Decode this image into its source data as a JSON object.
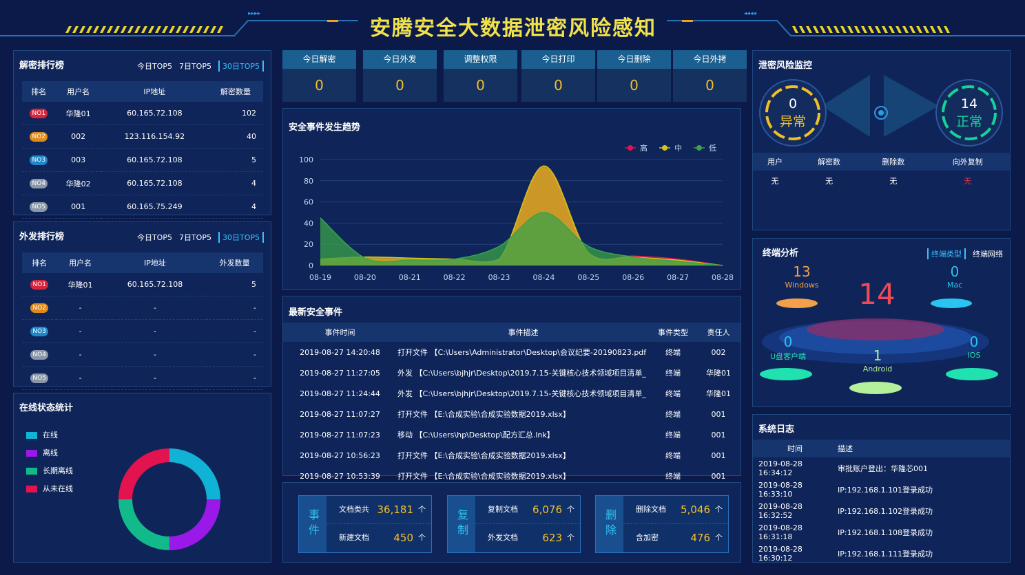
{
  "header": {
    "title": "安腾安全大数据泄密风险感知"
  },
  "decrypt_rank": {
    "title": "解密排行榜",
    "tabs": [
      "今日TOP5",
      "7日TOP5",
      "30日TOP5"
    ],
    "headers": [
      "排名",
      "用户名",
      "IP地址",
      "解密数量"
    ],
    "rows": [
      {
        "rank": "NO1",
        "user": "华隆01",
        "ip": "60.165.72.108",
        "count": "102"
      },
      {
        "rank": "NO2",
        "user": "002",
        "ip": "123.116.154.92",
        "count": "40"
      },
      {
        "rank": "NO3",
        "user": "003",
        "ip": "60.165.72.108",
        "count": "5"
      },
      {
        "rank": "NO4",
        "user": "华隆02",
        "ip": "60.165.72.108",
        "count": "4"
      },
      {
        "rank": "NO5",
        "user": "001",
        "ip": "60.165.75.249",
        "count": "4"
      }
    ]
  },
  "send_rank": {
    "title": "外发排行榜",
    "tabs": [
      "今日TOP5",
      "7日TOP5",
      "30日TOP5"
    ],
    "headers": [
      "排名",
      "用户名",
      "IP地址",
      "外发数量"
    ],
    "rows": [
      {
        "rank": "NO1",
        "user": "华隆01",
        "ip": "60.165.72.108",
        "count": "5"
      },
      {
        "rank": "NO2",
        "user": "-",
        "ip": "-",
        "count": "-"
      },
      {
        "rank": "NO3",
        "user": "-",
        "ip": "-",
        "count": "-"
      },
      {
        "rank": "NO4",
        "user": "-",
        "ip": "-",
        "count": "-"
      },
      {
        "rank": "NO5",
        "user": "-",
        "ip": "-",
        "count": "-"
      }
    ]
  },
  "badge_colors": [
    "#d9243b",
    "#e08a1c",
    "#1f86c8",
    "#8a97a8",
    "#8a97a8"
  ],
  "online": {
    "title": "在线状态统计",
    "legend": [
      {
        "label": "在线",
        "color": "#10b2d6",
        "value": 25
      },
      {
        "label": "离线",
        "color": "#9a18e8",
        "value": 25
      },
      {
        "label": "长期离线",
        "color": "#12b98a",
        "value": 25
      },
      {
        "label": "从未在线",
        "color": "#e2134f",
        "value": 25
      }
    ]
  },
  "kpis": [
    {
      "label": "今日解密",
      "value": "0"
    },
    {
      "label": "今日外发",
      "value": "0"
    },
    {
      "label": "调整权限",
      "value": "0"
    },
    {
      "label": "今日打印",
      "value": "0"
    },
    {
      "label": "今日删除",
      "value": "0"
    },
    {
      "label": "今日外拷",
      "value": "0"
    }
  ],
  "chart_data": {
    "type": "area",
    "title": "安全事件发生趋势",
    "categories": [
      "08-19",
      "08-20",
      "08-21",
      "08-22",
      "08-23",
      "08-24",
      "08-25",
      "08-26",
      "08-27",
      "08-28"
    ],
    "ylim": [
      0,
      100
    ],
    "yticks": [
      0,
      20,
      40,
      60,
      80,
      100
    ],
    "series": [
      {
        "name": "高",
        "color": "#e2134f",
        "values": [
          5,
          6,
          5,
          4,
          5,
          92,
          10,
          9,
          6,
          0
        ]
      },
      {
        "name": "中",
        "color": "#d6c41a",
        "values": [
          6,
          8,
          7,
          6,
          6,
          94,
          12,
          8,
          5,
          0
        ]
      },
      {
        "name": "低",
        "color": "#3aa34a",
        "values": [
          45,
          7,
          5,
          6,
          18,
          50,
          18,
          8,
          4,
          0
        ]
      }
    ]
  },
  "events": {
    "title": "最新安全事件",
    "headers": [
      "事件时间",
      "事件描述",
      "事件类型",
      "责任人"
    ],
    "rows": [
      {
        "time": "2019-08-27 14:20:48",
        "desc": "打开文件 【C:\\Users\\Administrator\\Desktop\\会议纪要-20190823.pdf",
        "type": "终端",
        "owner": "002"
      },
      {
        "time": "2019-08-27 11:27:05",
        "desc": "外发 【C:\\Users\\bjhjr\\Desktop\\2019.7.15-关键核心技术领域项目清单_",
        "type": "终端",
        "owner": "华隆01"
      },
      {
        "time": "2019-08-27 11:24:44",
        "desc": "外发 【C:\\Users\\bjhjr\\Desktop\\2019.7.15-关键核心技术领域项目清单_",
        "type": "终端",
        "owner": "华隆01"
      },
      {
        "time": "2019-08-27 11:07:27",
        "desc": "打开文件 【E:\\合成实验\\合成实验数据2019.xlsx】",
        "type": "终端",
        "owner": "001"
      },
      {
        "time": "2019-08-27 11:07:23",
        "desc": "移动 【C:\\Users\\hp\\Desktop\\配方汇总.lnk】",
        "type": "终端",
        "owner": "001"
      },
      {
        "time": "2019-08-27 10:56:23",
        "desc": "打开文件 【E:\\合成实验\\合成实验数据2019.xlsx】",
        "type": "终端",
        "owner": "001"
      },
      {
        "time": "2019-08-27 10:53:39",
        "desc": "打开文件 【E:\\合成实验\\合成实验数据2019.xlsx】",
        "type": "终端",
        "owner": "001"
      }
    ]
  },
  "stats": [
    {
      "cat": "事件",
      "rows": [
        {
          "label": "文档类共",
          "value": "36,181",
          "unit": "个"
        },
        {
          "label": "新建文档",
          "value": "450",
          "unit": "个"
        }
      ]
    },
    {
      "cat": "复制",
      "rows": [
        {
          "label": "复制文档",
          "value": "6,076",
          "unit": "个"
        },
        {
          "label": "外发文档",
          "value": "623",
          "unit": "个"
        }
      ]
    },
    {
      "cat": "删除",
      "rows": [
        {
          "label": "删除文档",
          "value": "5,046",
          "unit": "个"
        },
        {
          "label": "含加密",
          "value": "476",
          "unit": "个"
        }
      ]
    }
  ],
  "risk": {
    "title": "泄密风险监控",
    "abnormal": {
      "value": "0",
      "label": "异常"
    },
    "normal": {
      "value": "14",
      "label": "正常"
    },
    "headers": [
      "用户",
      "解密数",
      "删除数",
      "向外复制"
    ],
    "values": [
      "无",
      "无",
      "无",
      "无"
    ]
  },
  "terminal": {
    "title": "终端分析",
    "tabs": [
      "终端类型",
      "终端网络"
    ],
    "total": "14",
    "items": [
      {
        "name": "Windows",
        "value": "13"
      },
      {
        "name": "Mac",
        "value": "0"
      },
      {
        "name": "U盘客户端",
        "value": "0"
      },
      {
        "name": "Android",
        "value": "1"
      },
      {
        "name": "IOS",
        "value": "0"
      }
    ]
  },
  "syslog": {
    "title": "系统日志",
    "headers": [
      "时间",
      "描述"
    ],
    "rows": [
      {
        "time": "2019-08-28 16:34:12",
        "desc": "审批账户登出：华隆芯001"
      },
      {
        "time": "2019-08-28 16:33:10",
        "desc": "IP:192.168.1.101登录成功"
      },
      {
        "time": "2019-08-28 16:32:52",
        "desc": "IP:192.168.1.102登录成功"
      },
      {
        "time": "2019-08-28 16:31:18",
        "desc": "IP:192.168.1.108登录成功"
      },
      {
        "time": "2019-08-28 16:30:12",
        "desc": "IP:192.168.1.111登录成功"
      }
    ]
  }
}
